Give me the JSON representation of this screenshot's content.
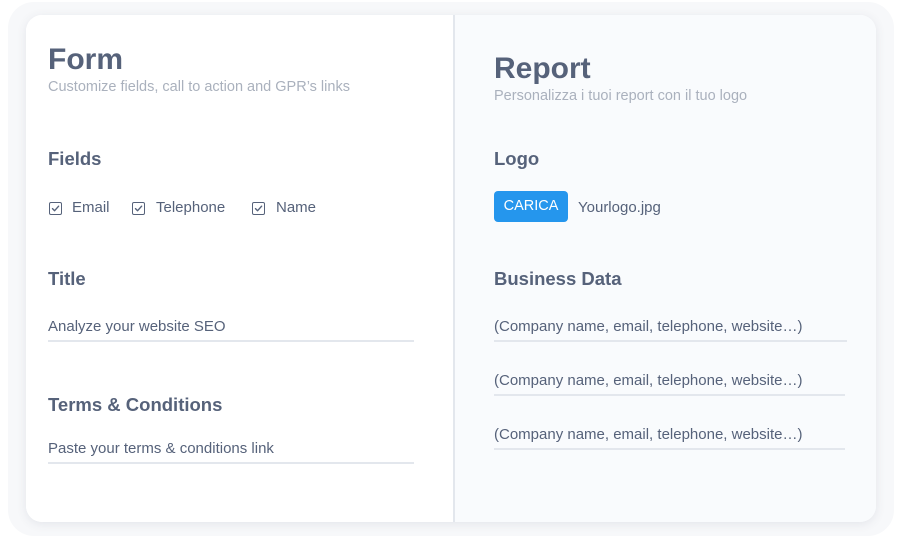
{
  "form": {
    "title": "Form",
    "subtitle": "Customize fields, call to action and GPR’s links",
    "fields_heading": "Fields",
    "checkboxes": [
      {
        "label": "Email",
        "checked": true
      },
      {
        "label": "Telephone",
        "checked": true
      },
      {
        "label": "Name",
        "checked": true
      }
    ],
    "title_heading": "Title",
    "title_value": "Analyze your website SEO",
    "terms_heading": "Terms & Conditions",
    "terms_value": "Paste your terms & conditions link"
  },
  "report": {
    "title": "Report",
    "subtitle": "Personalizza i tuoi report con il tuo logo",
    "logo_heading": "Logo",
    "upload_label": "CARICA",
    "logo_filename": "Yourlogo.jpg",
    "business_heading": "Business Data",
    "business_fields": [
      "(Company name, email, telephone, website…)",
      "(Company name, email, telephone, website…)",
      "(Company name, email, telephone, website…)"
    ]
  },
  "colors": {
    "accent": "#2596ed",
    "text": "#56627a",
    "muted": "#aab1bd",
    "line": "#e3e7ed"
  }
}
